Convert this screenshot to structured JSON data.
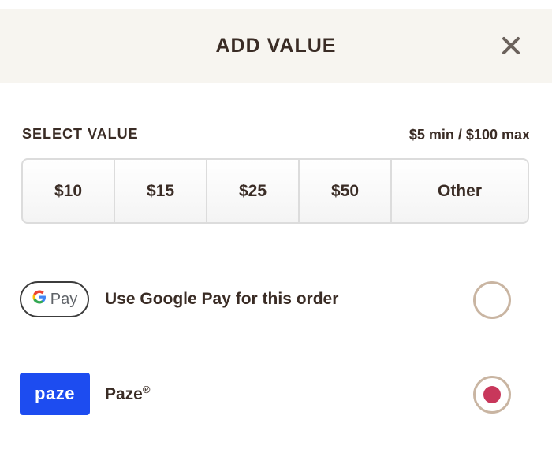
{
  "header": {
    "title": "ADD VALUE",
    "close_label": "×"
  },
  "select_value": {
    "label": "SELECT VALUE",
    "range": "$5 min / $100 max",
    "options": [
      "$10",
      "$15",
      "$25",
      "$50",
      "Other"
    ]
  },
  "payment_methods": {
    "google_pay": {
      "badge_g": "G",
      "badge_pay": "Pay",
      "label": "Use Google Pay for this order",
      "selected": false
    },
    "paze": {
      "badge": "paze",
      "label": "Paze",
      "trademark": "®",
      "selected": true
    }
  },
  "colors": {
    "header_bg": "#f7f5f0",
    "text": "#3a2c25",
    "radio_border": "#c9b5a2",
    "radio_selected": "#c8375b",
    "paze_blue": "#1d4cf0"
  }
}
